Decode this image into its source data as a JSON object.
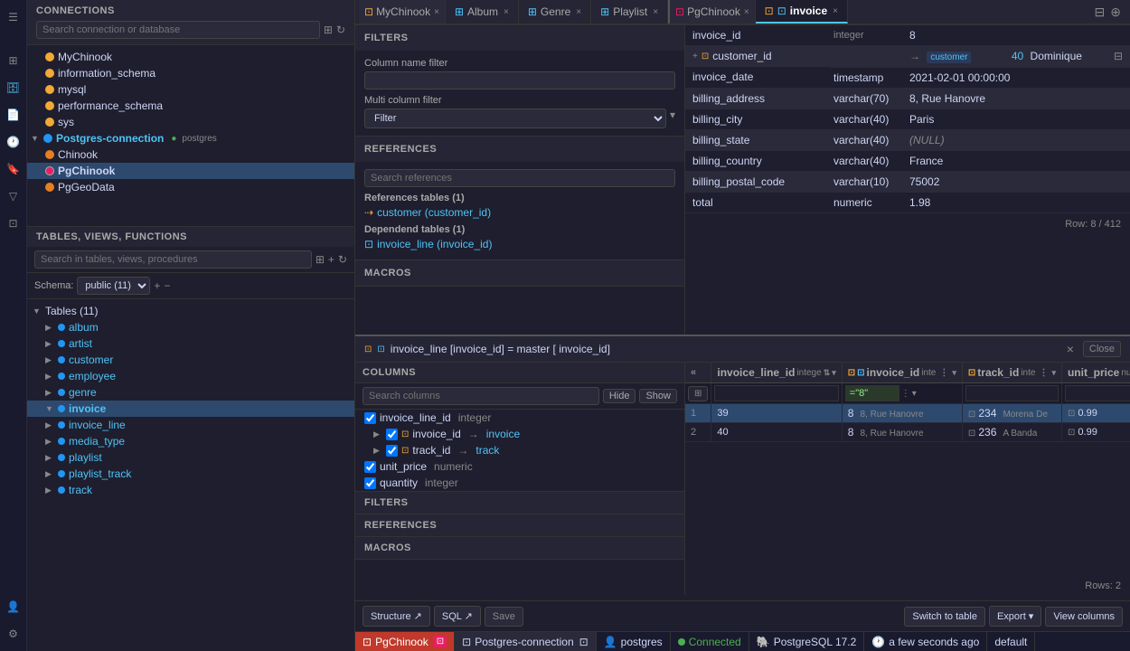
{
  "connections": {
    "title": "CONNECTIONS",
    "search_placeholder": "Search connection or database",
    "items": [
      {
        "id": "mychinook",
        "name": "MyChinook",
        "type": "db",
        "color": "yellow",
        "indent": 1
      },
      {
        "id": "info_schema",
        "name": "information_schema",
        "type": "db",
        "color": "yellow",
        "indent": 1
      },
      {
        "id": "mysql",
        "name": "mysql",
        "type": "db",
        "color": "yellow",
        "indent": 1
      },
      {
        "id": "performance_schema",
        "name": "performance_schema",
        "type": "db",
        "color": "yellow",
        "indent": 1
      },
      {
        "id": "sys",
        "name": "sys",
        "type": "db",
        "color": "yellow",
        "indent": 1
      },
      {
        "id": "postgres_conn",
        "name": "Postgres-connection",
        "type": "conn",
        "color": "green",
        "indent": 0
      },
      {
        "id": "chinook",
        "name": "Chinook",
        "type": "db",
        "color": "orange",
        "indent": 1
      },
      {
        "id": "pgchinook",
        "name": "PgChinook",
        "type": "db",
        "color": "pink",
        "indent": 1,
        "selected": true
      },
      {
        "id": "pggeoda",
        "name": "PgGeoData",
        "type": "db",
        "color": "orange",
        "indent": 1
      }
    ]
  },
  "tables": {
    "title": "TABLES, VIEWS, FUNCTIONS",
    "search_placeholder": "Search in tables, views, procedures",
    "schema_label": "Schema:",
    "schema_value": "public (11)",
    "tables_group": "Tables (11)",
    "items": [
      {
        "name": "album",
        "indent": 1
      },
      {
        "name": "artist",
        "indent": 1
      },
      {
        "name": "customer",
        "indent": 1
      },
      {
        "name": "employee",
        "indent": 1
      },
      {
        "name": "genre",
        "indent": 1
      },
      {
        "name": "invoice",
        "indent": 1,
        "selected": true
      },
      {
        "name": "invoice_line",
        "indent": 1
      },
      {
        "name": "media_type",
        "indent": 1
      },
      {
        "name": "playlist",
        "indent": 1
      },
      {
        "name": "playlist_track",
        "indent": 1
      },
      {
        "name": "track",
        "indent": 1
      }
    ]
  },
  "tabs": {
    "group1": {
      "label": "MyChinook",
      "tabs": [
        {
          "id": "album",
          "label": "Album",
          "icon": "table"
        },
        {
          "id": "genre",
          "label": "Genre",
          "icon": "table"
        },
        {
          "id": "playlist",
          "label": "Playlist",
          "icon": "table"
        }
      ]
    },
    "group2": {
      "label": "PgChinook",
      "tabs": [
        {
          "id": "invoice",
          "label": "invoice",
          "icon": "table",
          "active": true
        }
      ]
    }
  },
  "invoice": {
    "fields": [
      {
        "name": "invoice_id",
        "type": "integer",
        "value": "8"
      },
      {
        "name": "customer_id",
        "type": "",
        "value": "40",
        "fk": true,
        "fk_table": "customer",
        "extra": "Dominique"
      },
      {
        "name": "invoice_date",
        "type": "timestamp",
        "value": "2021-02-01 00:00:00"
      },
      {
        "name": "billing_address",
        "type": "varchar(70)",
        "value": "8, Rue Hanovre"
      },
      {
        "name": "billing_city",
        "type": "varchar(40)",
        "value": "Paris"
      },
      {
        "name": "billing_state",
        "type": "varchar(40)",
        "value": "(NULL)"
      },
      {
        "name": "billing_country",
        "type": "varchar(40)",
        "value": "France"
      },
      {
        "name": "billing_postal_code",
        "type": "varchar(10)",
        "value": "75002"
      },
      {
        "name": "total",
        "type": "numeric",
        "value": "1.98"
      }
    ],
    "row_counter": "Row: 8 / 412"
  },
  "filters_panel": {
    "title": "FILTERS",
    "col_filter_label": "Column name filter",
    "col_filter_placeholder": "",
    "multi_filter_label": "Multi column filter",
    "multi_filter_placeholder": "Filter"
  },
  "references_panel": {
    "title": "REFERENCES",
    "search_placeholder": "Search references",
    "ref_tables_label": "References tables (1)",
    "ref_table": "customer (customer_id)",
    "dep_tables_label": "Dependend tables (1)",
    "dep_table": "invoice_line (invoice_id)"
  },
  "macros_panel": {
    "title": "MACROS"
  },
  "invoice_line_panel": {
    "title": "invoice_line [invoice_id] = master [ invoice_id]",
    "close_label": "Close"
  },
  "columns_panel": {
    "title": "COLUMNS",
    "search_placeholder": "Search columns",
    "hide_label": "Hide",
    "show_label": "Show",
    "columns": [
      {
        "name": "invoice_line_id",
        "type": "integer",
        "checked": true,
        "indent": 0
      },
      {
        "name": "invoice_id",
        "type": "",
        "checked": true,
        "fk": true,
        "fk_table": "invoice",
        "indent": 1
      },
      {
        "name": "track_id",
        "type": "",
        "checked": true,
        "fk": true,
        "fk_table": "track",
        "indent": 1
      },
      {
        "name": "unit_price",
        "type": "numeric",
        "checked": true,
        "indent": 0
      },
      {
        "name": "quantity",
        "type": "integer",
        "checked": true,
        "indent": 0
      }
    ]
  },
  "il_filters": {
    "title": "FILTERS"
  },
  "il_references": {
    "title": "REFERENCES"
  },
  "il_macros": {
    "title": "MACROS"
  },
  "data_grid": {
    "columns": [
      {
        "name": "invoice_line_id",
        "type": "intege"
      },
      {
        "name": "invoice_id",
        "type": "inte"
      },
      {
        "name": "track_id",
        "type": "inte"
      },
      {
        "name": "unit_price",
        "type": "num"
      }
    ],
    "filter_row": [
      "",
      "=\"8\"",
      "",
      ""
    ],
    "rows": [
      {
        "num": "1",
        "cells": [
          "39",
          "8",
          "8, Rue Hanovre",
          "234",
          "Morena De",
          "0.99"
        ]
      },
      {
        "num": "2",
        "cells": [
          "40",
          "8",
          "8, Rue Hanovre",
          "236",
          "A Banda",
          "0.99"
        ]
      }
    ],
    "rows_count": "Rows: 2"
  },
  "bottom_toolbar": {
    "structure_label": "Structure ↗",
    "sql_label": "SQL ↗",
    "save_label": "Save",
    "switch_label": "Switch to table",
    "export_label": "Export ▾",
    "view_columns_label": "View columns"
  },
  "status_bar": {
    "db_name": "PgChinook",
    "connection": "Postgres-connection",
    "user": "postgres",
    "connected": "Connected",
    "pg_version": "PostgreSQL 17.2",
    "time_ago": "a few seconds ago",
    "default": "default"
  }
}
